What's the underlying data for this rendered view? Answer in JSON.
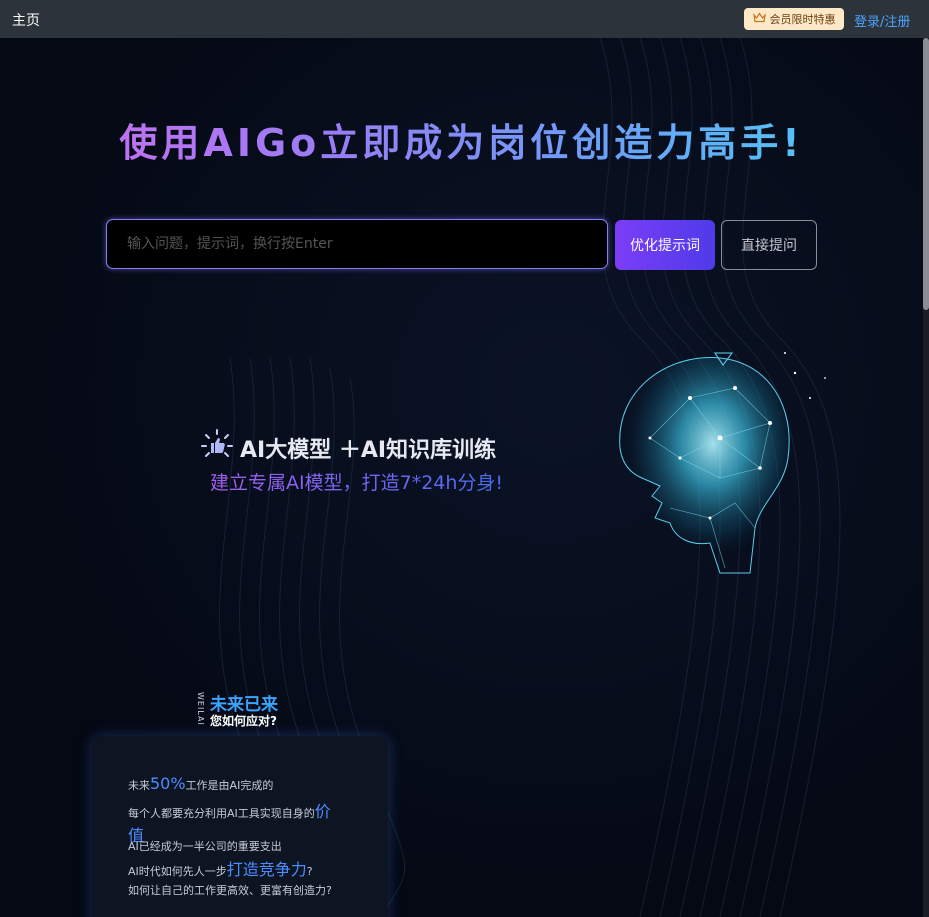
{
  "topbar": {
    "home": "主页",
    "vip_label": "会员限时特惠",
    "login": "登录/注册"
  },
  "hero": {
    "headline": "使用AIGo立即成为岗位创造力高手!",
    "search_placeholder": "输入问题，提示词，换行按Enter",
    "optimize_button": "优化提示词",
    "ask_button": "直接提问"
  },
  "feature": {
    "line1": "AI大模型 ＋AI知识库训练",
    "line2": "建立专属AI模型，打造7*24h分身!"
  },
  "future": {
    "side_text": "WEILAI",
    "title": "未来已来",
    "subtitle": "您如何应对?"
  },
  "card": {
    "r1_pre": "未来",
    "r1_hl": "50%",
    "r1_post": "工作是由AI完成的",
    "r2_pre": "每个人都要充分利用AI工具实现自身的",
    "r2_hl": "价值",
    "r3": "AI已经成为一半公司的重要支出",
    "r4_pre": "AI时代如何先人一步",
    "r4_hl": "打造竞争力",
    "r4_post": "?",
    "r5": "如何让自己的工作更高效、更富有创造力?"
  },
  "colors": {
    "background": "#050914",
    "topbar": "#2d333b",
    "accent_purple": "#7b3df5",
    "link_blue": "#4da3ff",
    "highlight_blue": "#4d8cff"
  },
  "icons": {
    "vip": "crown-icon",
    "feature": "thumbs-up-sparkle-icon"
  }
}
